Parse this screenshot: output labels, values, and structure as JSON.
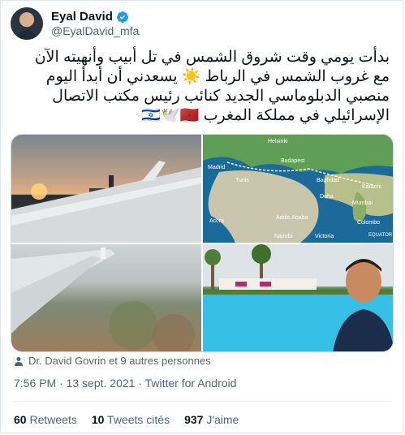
{
  "author": {
    "name": "Eyal David",
    "handle": "@EyalDavid_mfa"
  },
  "tweet": {
    "line1": "بدأت يومي وقت شروق الشمس في تل أبيب وأنهيته الآن",
    "line2": "مع غروب الشمس في الرباط ☀️ يسعدني أن أبدأ اليوم",
    "line3": "منصبي الدبلوماسي الجديد كنائب رئيس مكتب الاتصال",
    "line4": "الإسرائيلي في مملكة المغرب 🇮🇱🕊️🇲🇦"
  },
  "map_labels": {
    "helsinki": "Helsinki",
    "budapest": "Budapest",
    "madrid": "Madrid",
    "tunis": "Tunis",
    "baghdad": "Baghdad",
    "doha": "Doha",
    "karachi": "Karachi",
    "mumbai": "Mumbai",
    "colombo": "Colombo",
    "accra": "Accra",
    "addis": "Addis Ababa",
    "nairobi": "Nairobi",
    "victoria": "Victoria",
    "equator": "EQUATOR"
  },
  "attribution": "Dr. David Govrin et 9 autres personnes",
  "meta": "7:56 PM · 13 sept. 2021 · Twitter for Android",
  "stats": {
    "retweets_count": "60",
    "retweets_label": "Retweets",
    "quotes_count": "10",
    "quotes_label": "Tweets cités",
    "likes_count": "937",
    "likes_label": "J'aime"
  },
  "colors": {
    "verified": "#1d9bf0",
    "text_secondary": "#536471"
  }
}
